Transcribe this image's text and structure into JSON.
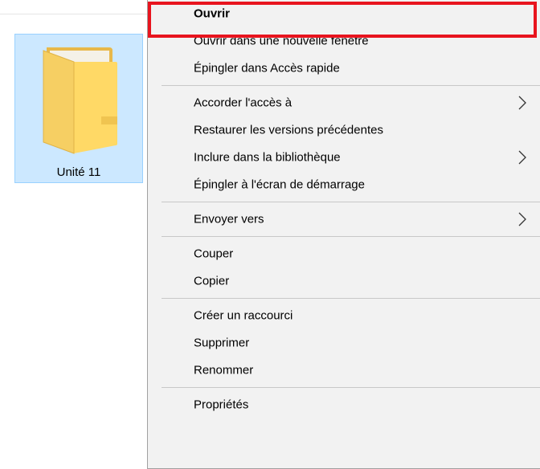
{
  "explorer": {
    "folder": {
      "name": "Unité 11",
      "icon": "folder-icon",
      "selected": true
    }
  },
  "context_menu": {
    "groups": [
      [
        {
          "id": "open",
          "label": "Ouvrir",
          "bold": true,
          "submenu": false,
          "highlighted": true
        },
        {
          "id": "open-new-window",
          "label": "Ouvrir dans une nouvelle fenêtre",
          "bold": false,
          "submenu": false
        },
        {
          "id": "pin-quick-access",
          "label": "Épingler dans Accès rapide",
          "bold": false,
          "submenu": false
        }
      ],
      [
        {
          "id": "give-access",
          "label": "Accorder l'accès à",
          "bold": false,
          "submenu": true
        },
        {
          "id": "restore-versions",
          "label": "Restaurer les versions précédentes",
          "bold": false,
          "submenu": false
        },
        {
          "id": "include-library",
          "label": "Inclure dans la bibliothèque",
          "bold": false,
          "submenu": true
        },
        {
          "id": "pin-start",
          "label": "Épingler à l'écran de démarrage",
          "bold": false,
          "submenu": false
        }
      ],
      [
        {
          "id": "send-to",
          "label": "Envoyer vers",
          "bold": false,
          "submenu": true
        }
      ],
      [
        {
          "id": "cut",
          "label": "Couper",
          "bold": false,
          "submenu": false
        },
        {
          "id": "copy",
          "label": "Copier",
          "bold": false,
          "submenu": false
        }
      ],
      [
        {
          "id": "create-shortcut",
          "label": "Créer un raccourci",
          "bold": false,
          "submenu": false
        },
        {
          "id": "delete",
          "label": "Supprimer",
          "bold": false,
          "submenu": false
        },
        {
          "id": "rename",
          "label": "Renommer",
          "bold": false,
          "submenu": false
        }
      ],
      [
        {
          "id": "properties",
          "label": "Propriétés",
          "bold": false,
          "submenu": false
        }
      ]
    ]
  },
  "colors": {
    "menu_background": "#f2f2f2",
    "selection_background": "#cce8ff",
    "selection_border": "#99d1ff",
    "highlight_frame": "#e8141e",
    "folder_front": "#ffd966",
    "folder_back": "#e8b84a"
  }
}
